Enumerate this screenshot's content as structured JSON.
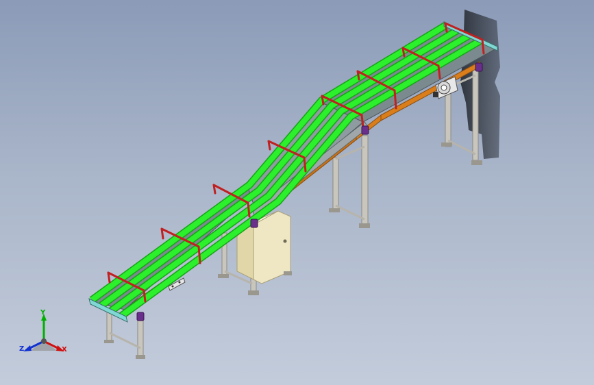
{
  "viewport": {
    "background_top": "#8b9bb8",
    "background_bottom": "#c3ccdb"
  },
  "model": {
    "name": "inclined-belt-conveyor",
    "colors": {
      "belt": "#2bf02b",
      "belt_shadow": "#17a317",
      "frame": "#7b8a8f",
      "side_rail": "#d97e1a",
      "support_leg": "#c9c6be",
      "guide_bracket": "#c02020",
      "cabinet": "#efe7c3",
      "motor": "#e8e8e8",
      "mount": "#6a2f8a"
    }
  },
  "triad": {
    "x_label": "X",
    "y_label": "Y",
    "z_label": "Z",
    "x_color": "#d01010",
    "y_color": "#00b000",
    "z_color": "#1030d0"
  }
}
